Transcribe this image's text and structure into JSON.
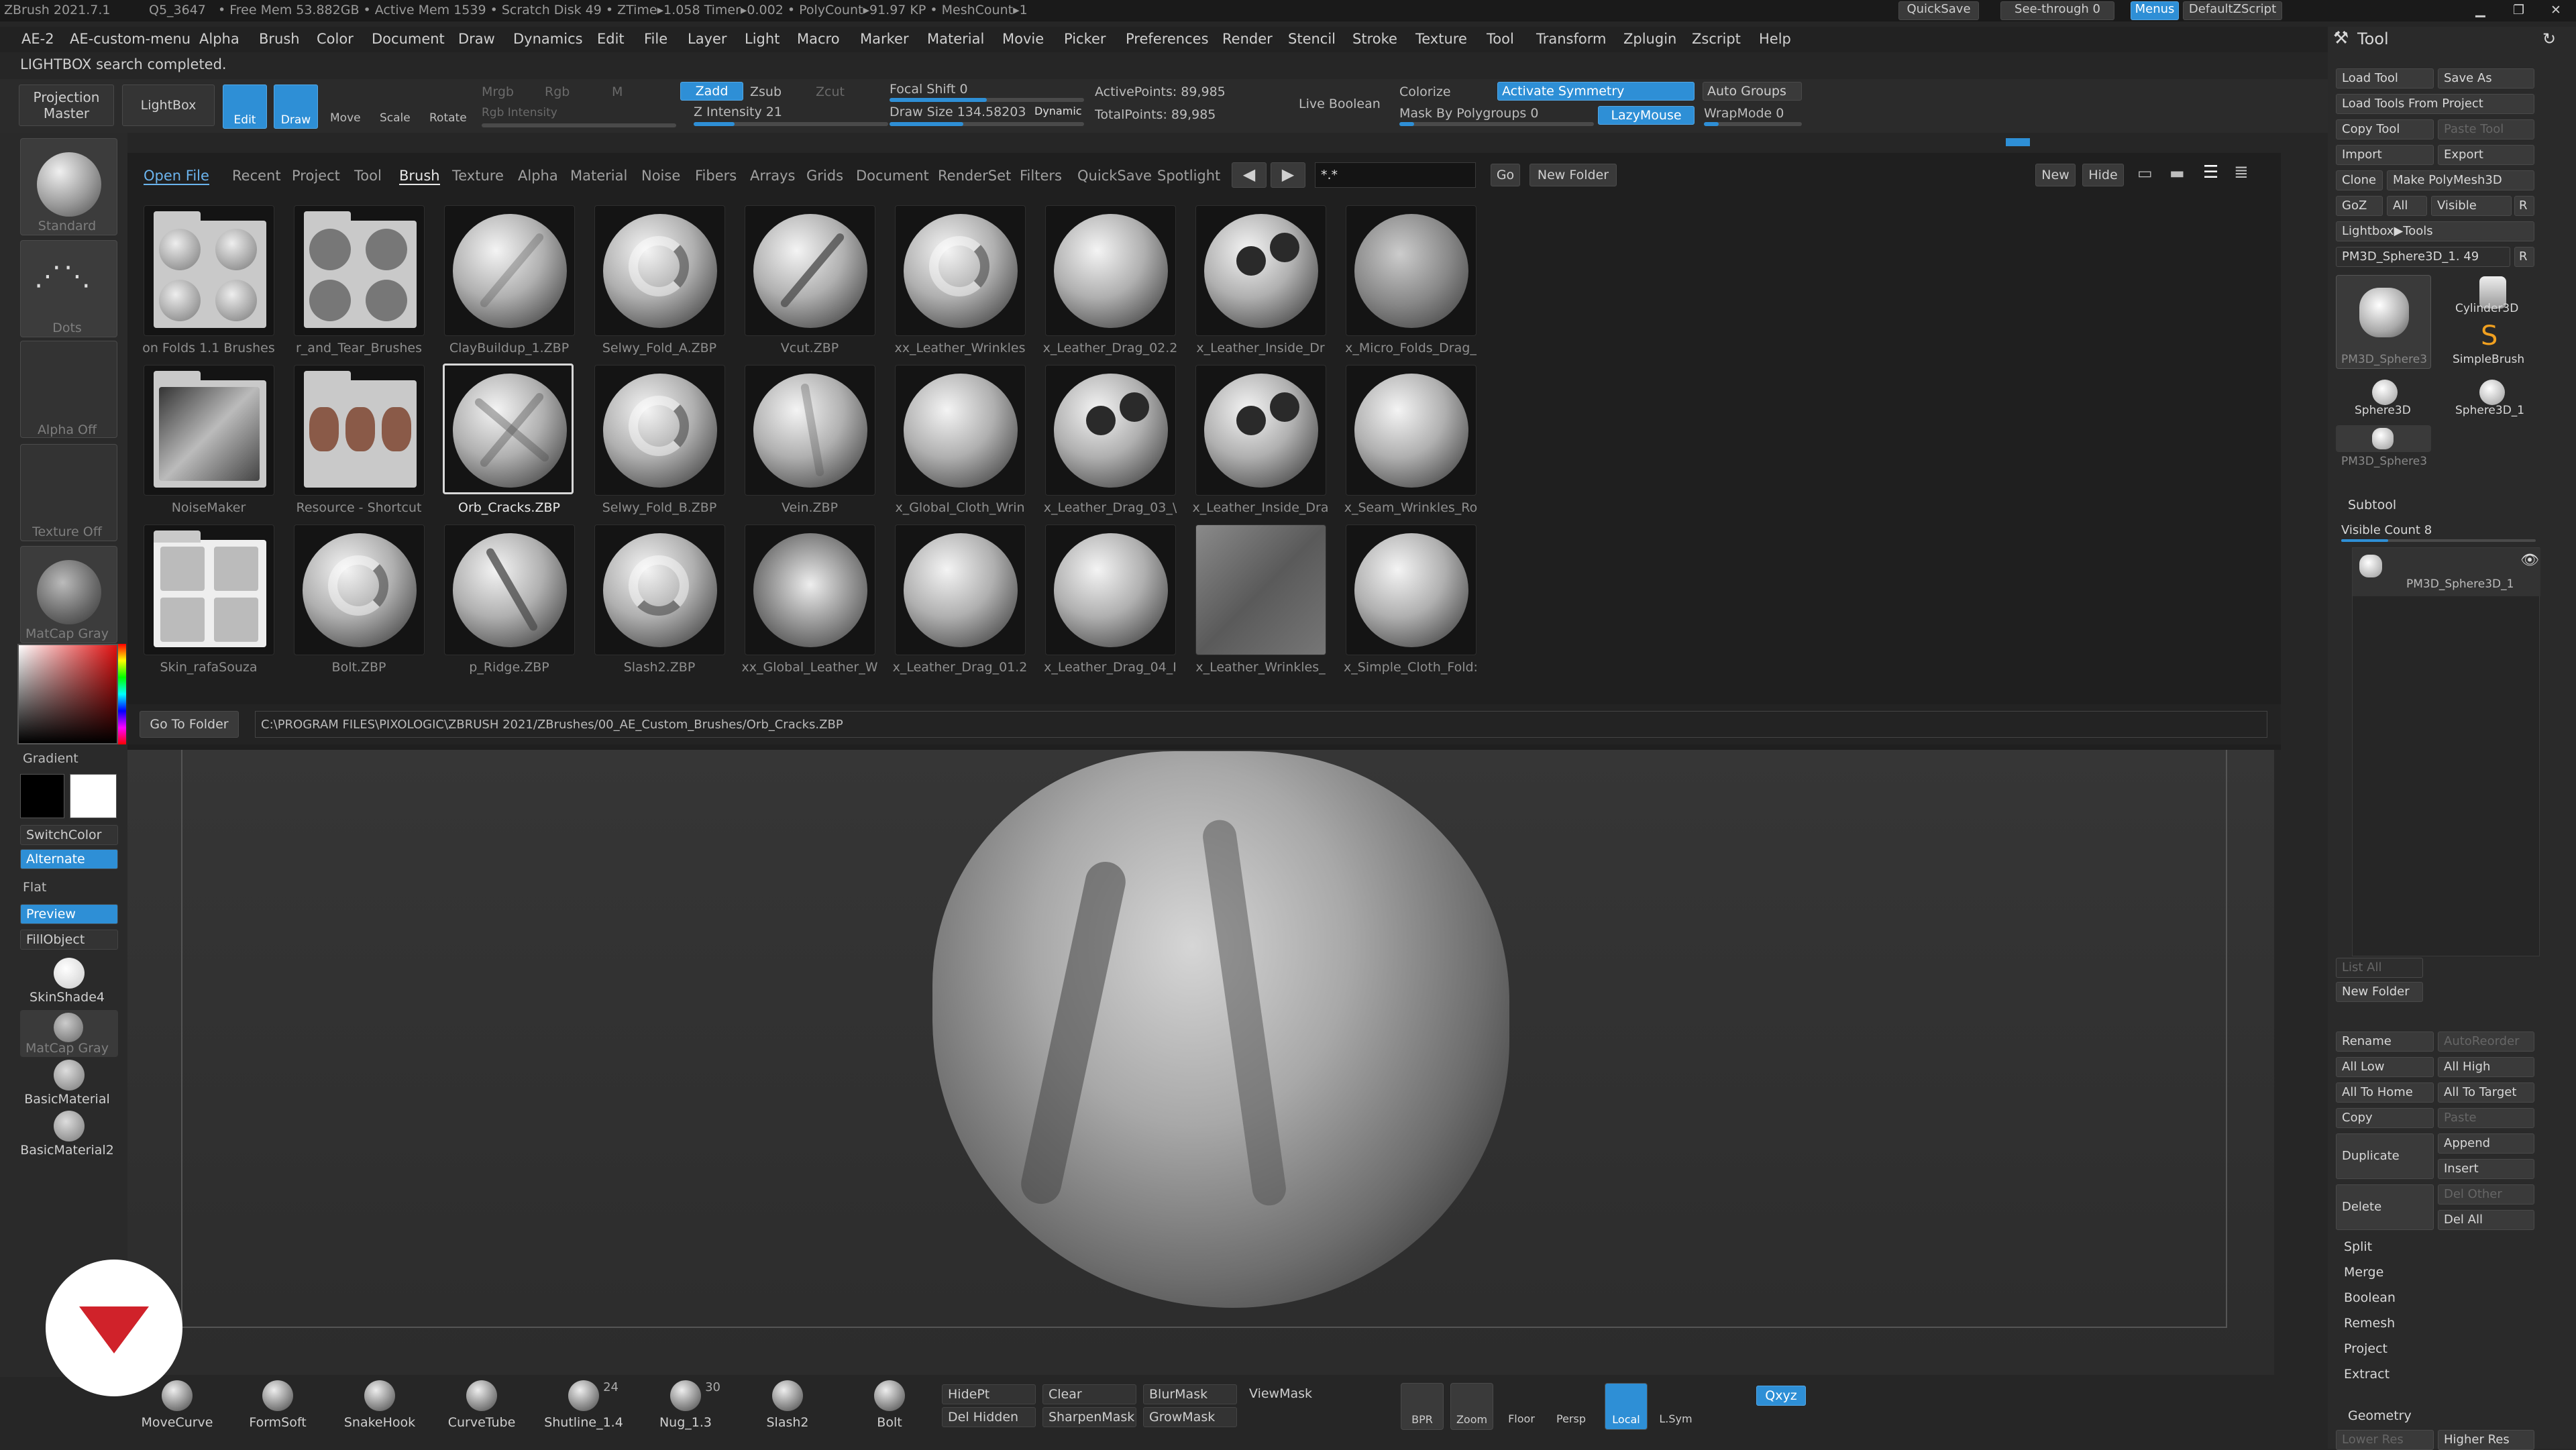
{
  "titlebar": {
    "app": "ZBrush 2021.7.1",
    "doc": "Q5_3647",
    "stats": "• Free Mem 53.882GB • Active Mem 1539 • Scratch Disk 49 • ZTime▸1.058 Timer▸0.002 • PolyCount▸91.97 KP • MeshCount▸1",
    "quicksave": "QuickSave",
    "seethrough": "See-through  0",
    "menus": "Menus",
    "script": "DefaultZScript"
  },
  "menu": [
    "AE-2",
    "AE-custom-menu",
    "Alpha",
    "Brush",
    "Color",
    "Document",
    "Draw",
    "Dynamics",
    "Edit",
    "File",
    "Layer",
    "Light",
    "Macro",
    "Marker",
    "Material",
    "Movie",
    "Picker",
    "Preferences",
    "Render",
    "Stencil",
    "Stroke",
    "Texture",
    "Tool",
    "Transform",
    "Zplugin",
    "Zscript",
    "Help"
  ],
  "status": "LIGHTBOX search completed.",
  "toolbar": {
    "projection": "Projection Master",
    "lightbox": "LightBox",
    "edit": "Edit",
    "draw": "Draw",
    "move": "Move",
    "scale": "Scale",
    "rotate": "Rotate",
    "mrgb": "Mrgb",
    "rgb": "Rgb",
    "m": "M",
    "rgb_intensity": "Rgb Intensity",
    "zadd": "Zadd",
    "zsub": "Zsub",
    "zcut": "Zcut",
    "z_intensity": "Z Intensity 21",
    "z_intensity_value": 0.21,
    "focal_shift": "Focal Shift 0",
    "draw_size": "Draw Size 134.58203",
    "dynamic": "Dynamic",
    "active_points": "ActivePoints: 89,985",
    "total_points": "TotalPoints: 89,985",
    "live_boolean": "Live Boolean",
    "colorize": "Colorize",
    "activate_symmetry": "Activate Symmetry",
    "auto_groups": "Auto Groups",
    "mask_by_polygroups": "Mask By Polygroups 0",
    "lazymouse": "LazyMouse",
    "wrapmode": "WrapMode 0"
  },
  "leftshelf": {
    "standard": "Standard",
    "dots": "Dots",
    "alpha_off": "Alpha Off",
    "texture_off": "Texture Off",
    "matcap_gray": "MatCap Gray",
    "gradient": "Gradient",
    "switchcolor": "SwitchColor",
    "alternate": "Alternate",
    "flat": "Flat",
    "preview": "Preview",
    "fillobject": "FillObject",
    "skinshade4": "SkinShade4",
    "matcap_gray2": "MatCap Gray",
    "basicmaterial": "BasicMaterial",
    "basicmaterial2": "BasicMaterial2"
  },
  "lightbox": {
    "tabs": [
      "Open File",
      "Recent",
      "Project",
      "Tool",
      "Brush",
      "Texture",
      "Alpha",
      "Material",
      "Noise",
      "Fibers",
      "Arrays",
      "Grids",
      "Document",
      "RenderSet",
      "Filters",
      "QuickSave",
      "Spotlight"
    ],
    "search": "*.*",
    "go": "Go",
    "new_folder": "New Folder",
    "new": "New",
    "hide": "Hide",
    "items": [
      "on Folds 1.1 Brushes",
      "r_and_Tear_Brushes",
      "ClayBuildup_1.ZBP",
      "Selwy_Fold_A.ZBP",
      "Vcut.ZBP",
      "xx_Leather_Wrinkles",
      "x_Leather_Drag_02.2",
      "x_Leather_Inside_Dr",
      "x_Micro_Folds_Drag_",
      "NoiseMaker",
      "Resource - Shortcut",
      "Orb_Cracks.ZBP",
      "Selwy_Fold_B.ZBP",
      "Vein.ZBP",
      "x_Global_Cloth_Wrin",
      "x_Leather_Drag_03_\\",
      "x_Leather_Inside_Dra",
      "x_Seam_Wrinkles_Ro",
      "Skin_rafaSouza",
      "Bolt.ZBP",
      "p_Ridge.ZBP",
      "Slash2.ZBP",
      "xx_Global_Leather_W",
      "x_Leather_Drag_01.2",
      "x_Leather_Drag_04_I",
      "x_Leather_Wrinkles_",
      "x_Simple_Cloth_Fold:"
    ],
    "selected": "Orb_Cracks.ZBP",
    "go_to_folder": "Go To Folder",
    "path": "C:\\PROGRAM FILES\\PIXOLOGIC\\ZBRUSH 2021/ZBrushes/00_AE_Custom_Brushes/Orb_Cracks.ZBP"
  },
  "tool": {
    "title": "Tool",
    "load_tool": "Load Tool",
    "save_as": "Save As",
    "load_from_project": "Load Tools From Project",
    "copy_tool": "Copy Tool",
    "paste_tool": "Paste Tool",
    "import": "Import",
    "export": "Export",
    "clone": "Clone",
    "make_polymesh": "Make PolyMesh3D",
    "goz": "GoZ",
    "all": "All",
    "visible": "Visible",
    "r": "R",
    "lightbox_tools": "Lightbox▶Tools",
    "current": "PM3D_Sphere3D_1. 49",
    "tools": [
      "PM3D_Sphere3",
      "Cylinder3D",
      "SimpleBrush",
      "Sphere3D",
      "Sphere3D_1",
      "PM3D_Sphere3"
    ],
    "subtool": "Subtool",
    "visible_count": "Visible Count 8",
    "subtool_item": "PM3D_Sphere3D_1",
    "list_all": "List All",
    "new_folder": "New Folder",
    "rename": "Rename",
    "autoreorder": "AutoReorder",
    "all_low": "All Low",
    "all_high": "All High",
    "all_to_home": "All To Home",
    "all_to_target": "All To Target",
    "copy": "Copy",
    "paste": "Paste",
    "duplicate": "Duplicate",
    "append": "Append",
    "insert": "Insert",
    "delete": "Delete",
    "del_other": "Del Other",
    "del_all": "Del All",
    "split": "Split",
    "merge": "Merge",
    "boolean": "Boolean",
    "remesh": "Remesh",
    "project": "Project",
    "extract": "Extract",
    "geometry": "Geometry",
    "lower_res": "Lower Res",
    "higher_res": "Higher Res"
  },
  "bottom": {
    "brushes": [
      {
        "name": "MoveCurve",
        "num": ""
      },
      {
        "name": "FormSoft",
        "num": ""
      },
      {
        "name": "SnakeHook",
        "num": ""
      },
      {
        "name": "CurveTube",
        "num": ""
      },
      {
        "name": "Shutline_1.4",
        "num": "24"
      },
      {
        "name": "Nug_1.3",
        "num": "30"
      },
      {
        "name": "Slash2",
        "num": ""
      },
      {
        "name": "Bolt",
        "num": ""
      }
    ],
    "hidept": "HidePt",
    "clear": "Clear",
    "blurmask": "BlurMask",
    "viewmask": "ViewMask",
    "delhidden": "Del Hidden",
    "sharpenmask": "SharpenMask",
    "growmask": "GrowMask",
    "bpr": "BPR",
    "zoom": "Zoom",
    "floor": "Floor",
    "persp": "Persp",
    "local": "Local",
    "lsym": "L.Sym",
    "xyz": "Qxyz"
  }
}
